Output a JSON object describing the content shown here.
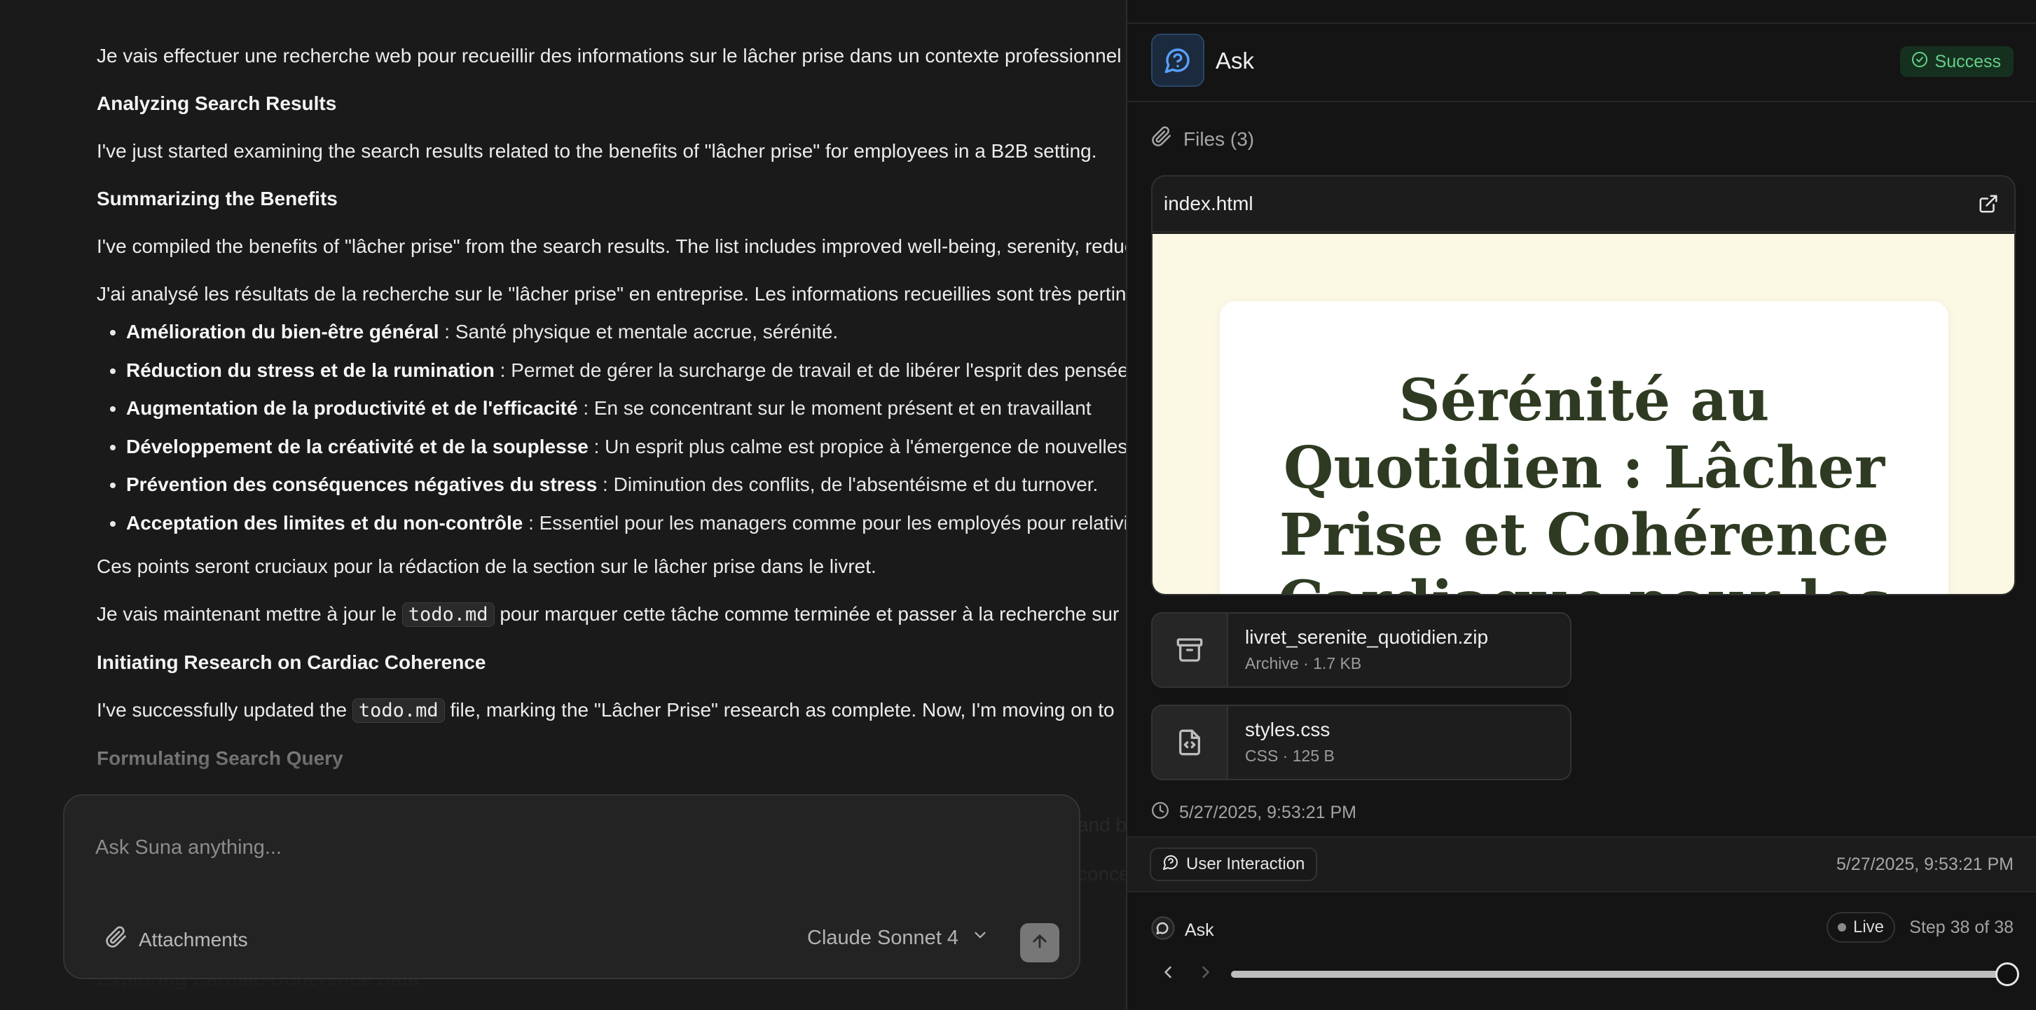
{
  "chat": {
    "line1": "Je vais effectuer une recherche web pour recueillir des informations sur le lâcher prise dans un contexte professionnel",
    "heading1": "Analyzing Search Results",
    "line2": "I've just started examining the search results related to the benefits of \"lâcher prise\" for employees in a B2B setting.",
    "heading2": "Summarizing the Benefits",
    "line3": "I've compiled the benefits of \"lâcher prise\" from the search results. The list includes improved well-being, serenity, reduced",
    "line4": "J'ai analysé les résultats de la recherche sur le \"lâcher prise\" en entreprise. Les informations recueillies sont très pertinentes",
    "bullets": [
      {
        "bold": "Amélioration du bien-être général",
        "rest": " : Santé physique et mentale accrue, sérénité."
      },
      {
        "bold": "Réduction du stress et de la rumination",
        "rest": " : Permet de gérer la surcharge de travail et de libérer l'esprit des pensées"
      },
      {
        "bold": "Augmentation de la productivité et de l'efficacité",
        "rest": " : En se concentrant sur le moment présent et en travaillant"
      },
      {
        "bold": "Développement de la créativité et de la souplesse",
        "rest": " : Un esprit plus calme est propice à l'émergence de nouvelles"
      },
      {
        "bold": "Prévention des conséquences négatives du stress",
        "rest": " : Diminution des conflits, de l'absentéisme et du turnover."
      },
      {
        "bold": "Acceptation des limites et du non-contrôle",
        "rest": " : Essentiel pour les managers comme pour les employés pour relativiser"
      }
    ],
    "line5": "Ces points seront cruciaux pour la rédaction de la section sur le lâcher prise dans le livret.",
    "line6_pre": "Je vais maintenant mettre à jour le ",
    "line6_code": "todo.md",
    "line6_post": " pour marquer cette tâche comme terminée et passer à la recherche sur la cohérence",
    "heading3": "Initiating Research on Cardiac Coherence",
    "line7_pre": "I've successfully updated the ",
    "line7_code": "todo.md",
    "line7_post": " file, marking the \"Lâcher Prise\" research as complete. Now, I'm moving on to",
    "heading4": "Formulating Search Query",
    "under1": "and b",
    "under2": "conce",
    "under3": "Exploring Cardiac Coherence Data"
  },
  "composer": {
    "placeholder": "Ask Suna anything...",
    "attachments_label": "Attachments",
    "model_label": "Claude Sonnet 4"
  },
  "panel": {
    "title": "Ask",
    "status": "Success",
    "files_label": "Files (3)",
    "preview": {
      "file_name": "index.html",
      "doc_title": "Sérénité au Quotidien : Lâcher Prise et Cohérence Cardiaque pour les"
    },
    "files": [
      {
        "name": "livret_serenite_quotidien.zip",
        "meta": "Archive · 1.7 KB",
        "icon": "archive-icon"
      },
      {
        "name": "styles.css",
        "meta": "CSS · 125 B",
        "icon": "file-code-icon"
      }
    ],
    "timestamp": "5/27/2025, 9:53:21 PM",
    "user_interaction_label": "User Interaction",
    "user_interaction_time": "5/27/2025, 9:53:21 PM",
    "step_tool": "Ask",
    "live_label": "Live",
    "step_label": "Step 38 of 38",
    "progress": 1.0,
    "colors": {
      "success": "#63d089",
      "accent_blue": "#5aa0ff",
      "preview_bg": "#fbf8e4",
      "doc_title": "#2e3b22"
    }
  }
}
